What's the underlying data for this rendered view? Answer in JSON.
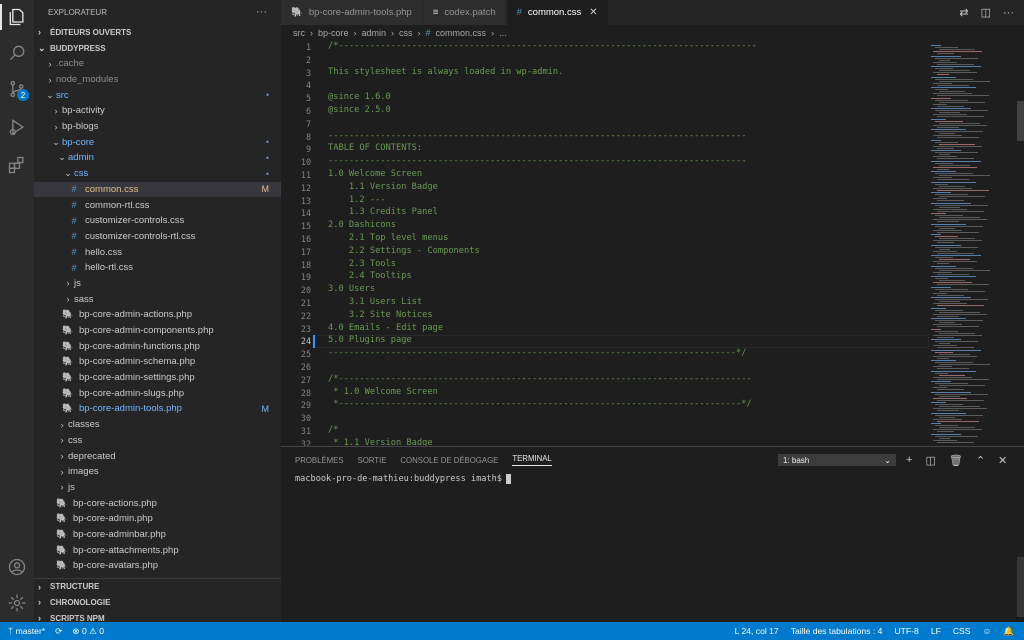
{
  "sidebar": {
    "title": "EXPLORATEUR",
    "more": "···",
    "open_editors": "ÉDITEURS OUVERTS",
    "root": "BUDDYPRESS",
    "items": [
      {
        "label": ".cache",
        "depth": 1,
        "kind": "folder",
        "open": false,
        "style": "dim"
      },
      {
        "label": "node_modules",
        "depth": 1,
        "kind": "folder",
        "open": false,
        "style": "dim"
      },
      {
        "label": "src",
        "depth": 1,
        "kind": "folder",
        "open": true,
        "style": "blue",
        "status": "•"
      },
      {
        "label": "bp-activity",
        "depth": 2,
        "kind": "folder",
        "open": false
      },
      {
        "label": "bp-blogs",
        "depth": 2,
        "kind": "folder",
        "open": false
      },
      {
        "label": "bp-core",
        "depth": 2,
        "kind": "folder",
        "open": true,
        "style": "blue",
        "status": "•"
      },
      {
        "label": "admin",
        "depth": 3,
        "kind": "folder",
        "open": true,
        "style": "blue",
        "status": "•"
      },
      {
        "label": "css",
        "depth": 4,
        "kind": "folder",
        "open": true,
        "style": "blue",
        "status": "•"
      },
      {
        "label": "common.css",
        "depth": 5,
        "kind": "css",
        "style": "modified",
        "status": "M",
        "selected": true
      },
      {
        "label": "common-rtl.css",
        "depth": 5,
        "kind": "css"
      },
      {
        "label": "customizer-controls.css",
        "depth": 5,
        "kind": "css"
      },
      {
        "label": "customizer-controls-rtl.css",
        "depth": 5,
        "kind": "css"
      },
      {
        "label": "hello.css",
        "depth": 5,
        "kind": "css"
      },
      {
        "label": "hello-rtl.css",
        "depth": 5,
        "kind": "css"
      },
      {
        "label": "js",
        "depth": 4,
        "kind": "folder",
        "open": false
      },
      {
        "label": "sass",
        "depth": 4,
        "kind": "folder",
        "open": false
      },
      {
        "label": "bp-core-admin-actions.php",
        "depth": 4,
        "kind": "php"
      },
      {
        "label": "bp-core-admin-components.php",
        "depth": 4,
        "kind": "php"
      },
      {
        "label": "bp-core-admin-functions.php",
        "depth": 4,
        "kind": "php"
      },
      {
        "label": "bp-core-admin-schema.php",
        "depth": 4,
        "kind": "php"
      },
      {
        "label": "bp-core-admin-settings.php",
        "depth": 4,
        "kind": "php"
      },
      {
        "label": "bp-core-admin-slugs.php",
        "depth": 4,
        "kind": "php"
      },
      {
        "label": "bp-core-admin-tools.php",
        "depth": 4,
        "kind": "php",
        "style": "blue",
        "status": "M"
      },
      {
        "label": "classes",
        "depth": 3,
        "kind": "folder",
        "open": false
      },
      {
        "label": "css",
        "depth": 3,
        "kind": "folder",
        "open": false
      },
      {
        "label": "deprecated",
        "depth": 3,
        "kind": "folder",
        "open": false
      },
      {
        "label": "images",
        "depth": 3,
        "kind": "folder",
        "open": false
      },
      {
        "label": "js",
        "depth": 3,
        "kind": "folder",
        "open": false
      },
      {
        "label": "bp-core-actions.php",
        "depth": 3,
        "kind": "php"
      },
      {
        "label": "bp-core-admin.php",
        "depth": 3,
        "kind": "php"
      },
      {
        "label": "bp-core-adminbar.php",
        "depth": 3,
        "kind": "php"
      },
      {
        "label": "bp-core-attachments.php",
        "depth": 3,
        "kind": "php"
      },
      {
        "label": "bp-core-avatars.php",
        "depth": 3,
        "kind": "php"
      }
    ],
    "sections": [
      "STRUCTURE",
      "CHRONOLOGIE",
      "SCRIPTS NPM"
    ]
  },
  "tabs": [
    {
      "label": "bp-core-admin-tools.php",
      "icon": "php-elephant-icon",
      "active": false
    },
    {
      "label": "codex.patch",
      "icon": "patch-lines-icon",
      "active": false
    },
    {
      "label": "common.css",
      "icon": "css-hash-icon",
      "active": true
    }
  ],
  "breadcrumb": [
    "src",
    "bp-core",
    "admin",
    "css",
    "common.css",
    "..."
  ],
  "editor": {
    "current_line": 24,
    "lines": [
      "/*--------------------------------------------------------------------------------",
      "",
      "This stylesheet is always loaded in wp-admin.",
      "",
      "@since 1.6.0",
      "@since 2.5.0",
      "",
      "--------------------------------------------------------------------------------",
      "TABLE OF CONTENTS:",
      "--------------------------------------------------------------------------------",
      "1.0 Welcome Screen",
      "    1.1 Version Badge",
      "    1.2 ---",
      "    1.3 Credits Panel",
      "2.0 Dashicons",
      "    2.1 Top level menus",
      "    2.2 Settings - Components",
      "    2.3 Tools",
      "    2.4 Tooltips",
      "3.0 Users",
      "    3.1 Users List",
      "    3.2 Site Notices",
      "4.0 Emails - Edit page",
      "5.0 Plugins page",
      "------------------------------------------------------------------------------*/",
      "",
      "/*-------------------------------------------------------------------------------",
      " * 1.0 Welcome Screen",
      " *-----------------------------------------------------------------------------*/",
      "",
      "/*",
      " * 1.1 Version Badge"
    ]
  },
  "panel": {
    "tabs": [
      "PROBLÈMES",
      "SORTIE",
      "CONSOLE DE DÉBOGAGE",
      "TERMINAL"
    ],
    "active_tab": "TERMINAL",
    "terminal_select": "1: bash",
    "prompt": "macbook-pro-de-mathieu:buddypress imath$"
  },
  "status": {
    "branch": "master*",
    "errors": "0",
    "warnings": "0",
    "position": "L 24, col 17",
    "tab_size": "Taille des tabulations : 4",
    "encoding": "UTF-8",
    "eol": "LF",
    "language": "CSS",
    "scm_badge": "2"
  },
  "colors": {
    "accent": "#007acc",
    "comment": "#6a9955",
    "modified": "#e2c08d",
    "folder_blue": "#73b6ff"
  }
}
